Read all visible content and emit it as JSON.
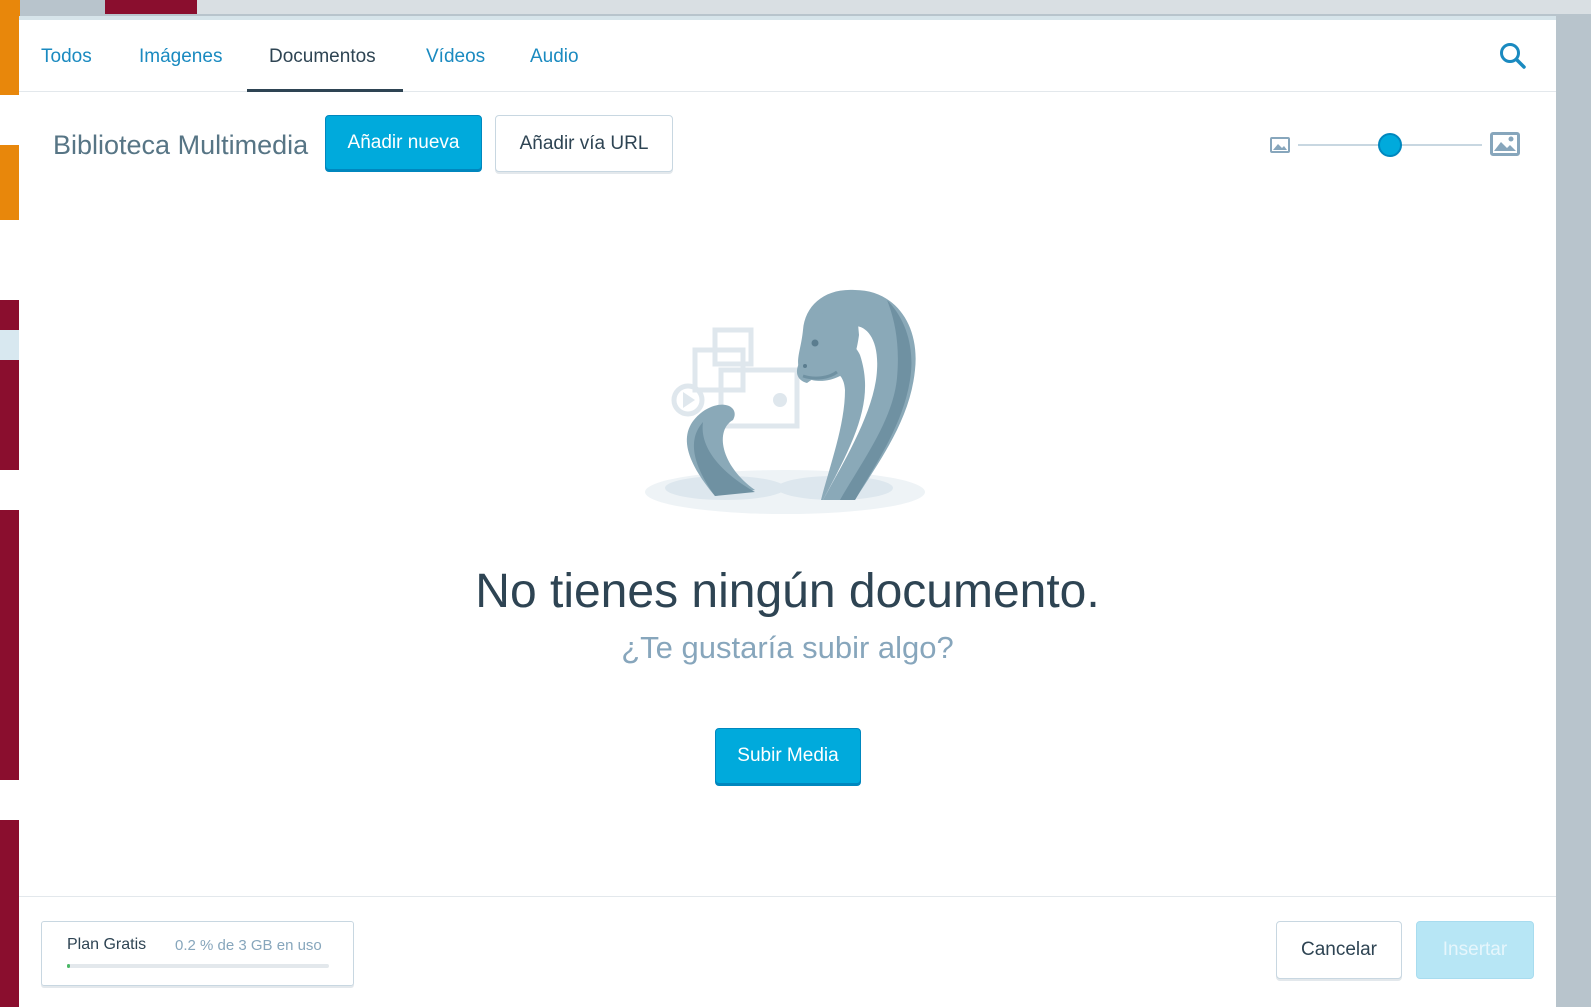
{
  "tabs": [
    {
      "label": "Todos"
    },
    {
      "label": "Imágenes"
    },
    {
      "label": "Documentos"
    },
    {
      "label": "Vídeos"
    },
    {
      "label": "Audio"
    }
  ],
  "active_tab": "Documentos",
  "header": {
    "title": "Biblioteca Multimedia",
    "add_new_label": "Añadir nueva",
    "add_url_label": "Añadir vía URL"
  },
  "thumbnail_size_slider": {
    "value_fraction": 0.5
  },
  "empty_state": {
    "title": "No tienes ningún documento.",
    "subtitle": "¿Te gustaría subir algo?",
    "upload_label": "Subir Media"
  },
  "footer": {
    "plan_name": "Plan Gratis",
    "usage_text": "0.2 % de 3 GB en uso",
    "usage_fraction": 0.002,
    "cancel_label": "Cancelar",
    "insert_label": "Insertar"
  },
  "colors": {
    "accent": "#00aadc",
    "link": "#1a8ac0",
    "text": "#2e4453"
  }
}
